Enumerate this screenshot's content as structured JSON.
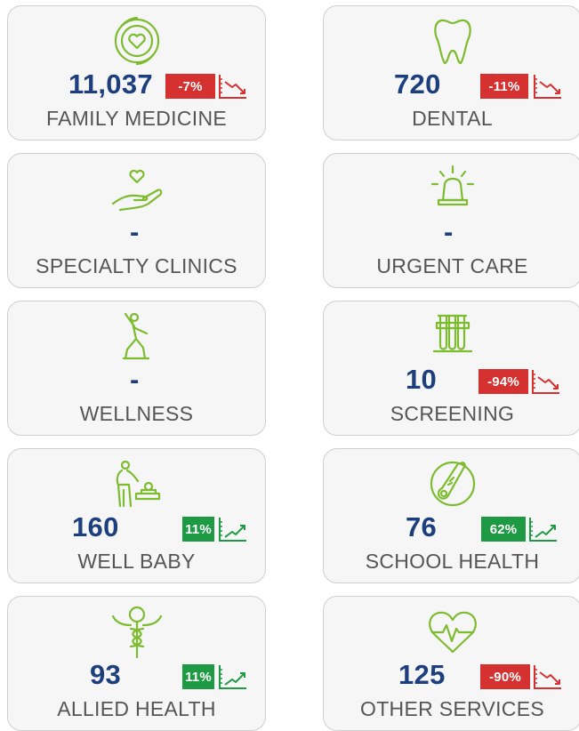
{
  "colors": {
    "value_text": "#1d3f7d",
    "label_text": "#555555",
    "icon_green": "#7dbb2f",
    "badge_down": "#d53131",
    "badge_up": "#1f9a44",
    "card_bg": "#f6f6f6",
    "card_border": "#cfcfcf"
  },
  "cards": [
    {
      "label": "FAMILY MEDICINE",
      "value": "11,037",
      "change": "-7%",
      "direction": "down",
      "icon": "heart-circle-icon"
    },
    {
      "label": "DENTAL",
      "value": "720",
      "change": "-11%",
      "direction": "down",
      "icon": "tooth-icon"
    },
    {
      "label": "SPECIALTY CLINICS",
      "value": "-",
      "change": "",
      "direction": "none",
      "icon": "hand-heart-icon"
    },
    {
      "label": "URGENT CARE",
      "value": "-",
      "change": "",
      "direction": "none",
      "icon": "siren-icon"
    },
    {
      "label": "WELLNESS",
      "value": "-",
      "change": "",
      "direction": "none",
      "icon": "yoga-pose-icon"
    },
    {
      "label": "SCREENING",
      "value": "10",
      "change": "-94%",
      "direction": "down",
      "icon": "test-tubes-icon"
    },
    {
      "label": "WELL BABY",
      "value": "160",
      "change": "11%",
      "direction": "up",
      "icon": "baby-care-icon"
    },
    {
      "label": "SCHOOL HEALTH",
      "value": "76",
      "change": "62%",
      "direction": "up",
      "icon": "thermometer-icon"
    },
    {
      "label": "ALLIED HEALTH",
      "value": "93",
      "change": "11%",
      "direction": "up",
      "icon": "caduceus-icon"
    },
    {
      "label": "OTHER SERVICES",
      "value": "125",
      "change": "-90%",
      "direction": "down",
      "icon": "heartbeat-icon"
    }
  ]
}
